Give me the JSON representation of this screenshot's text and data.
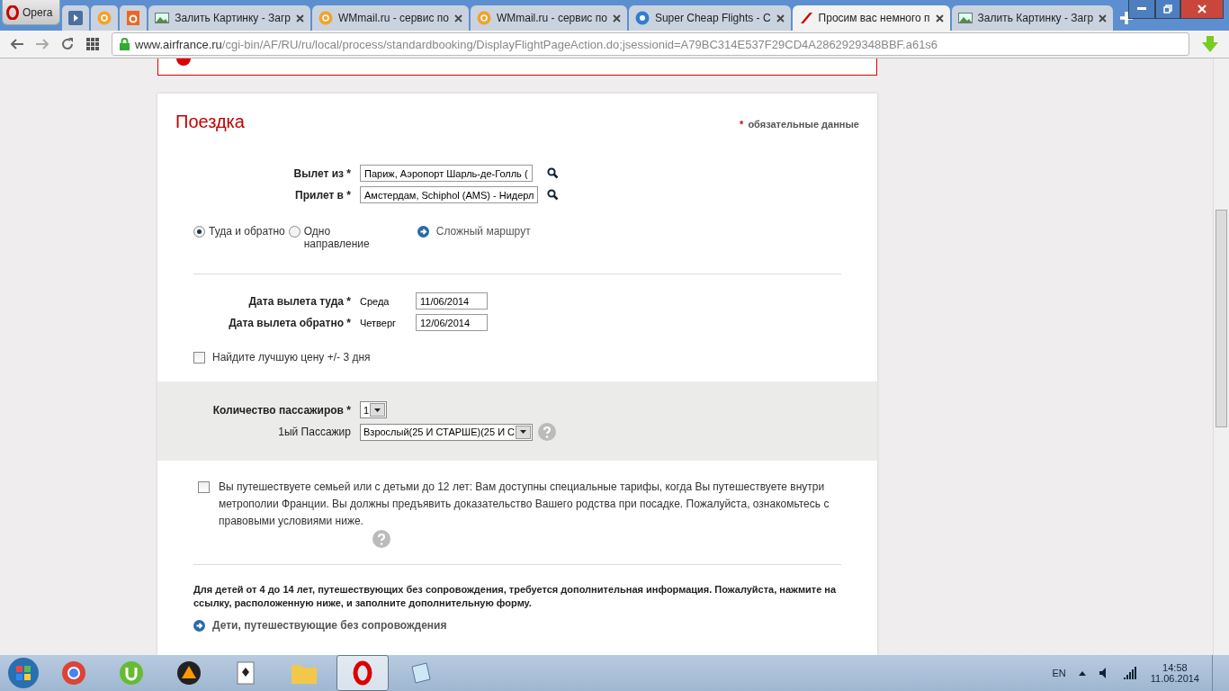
{
  "browser": {
    "menu_button": "Opera",
    "tabs": [
      {
        "title": "Залить Картинку - Загр",
        "kind": "image",
        "selected": false
      },
      {
        "title": "WMmail.ru - сервис по",
        "kind": "mail",
        "selected": false
      },
      {
        "title": "WMmail.ru - сервис по",
        "kind": "mail",
        "selected": false
      },
      {
        "title": "Super Cheap Flights - C",
        "kind": "bb",
        "selected": false
      },
      {
        "title": "Просим вас немного п",
        "kind": "stripe",
        "selected": true
      },
      {
        "title": "Залить Картинку - Загр",
        "kind": "image",
        "selected": false
      }
    ],
    "url_host": "www.airfrance.ru",
    "url_path": "/cgi-bin/AF/RU/ru/local/process/standardbooking/DisplayFlightPageAction.do;jsessionid=A79BC314E537F29CD4A2862929348BBF.a61s6"
  },
  "form": {
    "title": "Поездка",
    "required_mark": "*",
    "required_note": "обязательные данные",
    "places": [
      {
        "label": "Вылет из *",
        "value": "Париж, Аэропорт Шарль-де-Голль ("
      },
      {
        "label": "Прилет в *",
        "value": "Амстердам, Schiphol (AMS) - Нидерл"
      }
    ],
    "trip_type": [
      {
        "label": "Туда и обратно",
        "selected": true
      },
      {
        "label": "Одно направление",
        "selected": false
      }
    ],
    "complex_route": "Сложный маршрут",
    "dates": [
      {
        "label": "Дата вылета туда *",
        "weekday": "Среда",
        "value": "11/06/2014"
      },
      {
        "label": "Дата вылета обратно *",
        "weekday": "Четверг",
        "value": "12/06/2014"
      }
    ],
    "best_price": {
      "label": "Найдите лучшую цену +/- 3 дня",
      "checked": false
    },
    "passengers": {
      "count_label": "Количество пассажиров *",
      "count": "1",
      "passenger_label": "1ый Пассажир",
      "passenger_type": "Взрослый(25 И СТАРШЕ)(25 И С"
    },
    "family": {
      "text": "Вы путешествуете семьей или с детьми до 12 лет: Вам доступны специальные тарифы, когда Вы путешествуете внутри метрополии Франции. Вы должны предъявить доказательство Вашего родства при посадке. Пожалуйста, ознакомьтесь с правовыми условиями ниже.",
      "checked": false
    },
    "unaccompanied": {
      "text": "Для детей от 4 до 14 лет, путешествующих без сопровождения, требуется дополнительная информация. Пожалуйста, нажмите на ссылку, расположенную ниже, и заполните дополнительную форму.",
      "link": "Дети, путешествующие без сопровождения"
    }
  },
  "taskbar": {
    "language": "EN",
    "time": "14:58",
    "date": "11.06.2014"
  }
}
